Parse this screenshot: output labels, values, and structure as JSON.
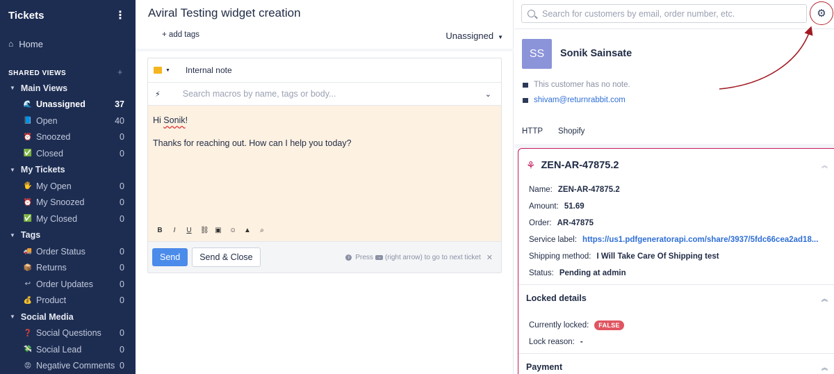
{
  "sidebar": {
    "title": "Tickets",
    "home": "Home",
    "shared_views": "SHARED VIEWS",
    "groups": [
      {
        "label": "Main Views",
        "items": [
          {
            "emoji": "🌊",
            "label": "Unassigned",
            "count": "37",
            "active": true
          },
          {
            "emoji": "📘",
            "label": "Open",
            "count": "40"
          },
          {
            "emoji": "⏰",
            "label": "Snoozed",
            "count": "0"
          },
          {
            "emoji": "✅",
            "label": "Closed",
            "count": "0"
          }
        ]
      },
      {
        "label": "My Tickets",
        "items": [
          {
            "emoji": "🖐",
            "label": "My Open",
            "count": "0"
          },
          {
            "emoji": "⏰",
            "label": "My Snoozed",
            "count": "0"
          },
          {
            "emoji": "✅",
            "label": "My Closed",
            "count": "0"
          }
        ]
      },
      {
        "label": "Tags",
        "items": [
          {
            "emoji": "🚚",
            "label": "Order Status",
            "count": "0"
          },
          {
            "emoji": "📦",
            "label": "Returns",
            "count": "0"
          },
          {
            "emoji": "↩",
            "label": "Order Updates",
            "count": "0"
          },
          {
            "emoji": "💰",
            "label": "Product",
            "count": "0"
          }
        ]
      },
      {
        "label": "Social Media",
        "items": [
          {
            "emoji": "❓",
            "label": "Social Questions",
            "count": "0"
          },
          {
            "emoji": "💸",
            "label": "Social Lead",
            "count": "0"
          },
          {
            "emoji": "😡",
            "label": "Negative Comments",
            "count": "0"
          }
        ]
      }
    ]
  },
  "ticket": {
    "title": "Aviral Testing widget creation",
    "add_tags": "add tags",
    "assignee": "Unassigned"
  },
  "composer": {
    "mode": "Internal note",
    "macro_placeholder": "Search macros by name, tags or body...",
    "greeting_prefix": "Hi ",
    "greeting_name": "Sonik",
    "greeting_suffix": "!",
    "body": "Thanks for reaching out. How can I help you today?",
    "send": "Send",
    "send_close": "Send & Close",
    "hint_prefix": "Press",
    "hint_suffix": "(right arrow) to go to next ticket"
  },
  "customer": {
    "search_placeholder": "Search for customers by email, order number, etc.",
    "initials": "SS",
    "name": "Sonik Sainsate",
    "note": "This customer has no note.",
    "email": "shivam@returnrabbit.com",
    "tabs": [
      "HTTP",
      "Shopify"
    ]
  },
  "widget": {
    "title": "ZEN-AR-47875.2",
    "fields": [
      {
        "k": "Name:",
        "v": "ZEN-AR-47875.2"
      },
      {
        "k": "Amount:",
        "v": "51.69"
      },
      {
        "k": "Order:",
        "v": "AR-47875"
      },
      {
        "k": "Service label:",
        "v": "https://us1.pdfgeneratorapi.com/share/3937/5fdc66cea2ad18...",
        "link": true
      },
      {
        "k": "Shipping method:",
        "v": "I Will Take Care Of Shipping test"
      },
      {
        "k": "Status:",
        "v": "Pending at admin"
      }
    ],
    "locked_title": "Locked details",
    "currently_locked_label": "Currently locked:",
    "currently_locked_value": "FALSE",
    "lock_reason_label": "Lock reason:",
    "lock_reason_value": "-",
    "payment_title": "Payment"
  },
  "colors": {
    "sidebar_bg": "#1d2d52",
    "accent": "#4b8bea",
    "annotation": "#b3262e",
    "widget_border": "#c2185b"
  }
}
